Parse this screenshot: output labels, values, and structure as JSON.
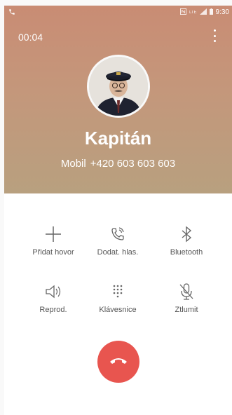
{
  "status_bar": {
    "left_icon": "phone-call-icon",
    "right_icons": [
      "nfc-icon",
      "lte-icon",
      "signal-icon",
      "battery-icon"
    ],
    "lte_label": "LTE",
    "time": "9:30"
  },
  "call": {
    "timer": "00:04",
    "contact_name": "Kapitán",
    "number_label": "Mobil",
    "number": "+420 603 603 603"
  },
  "controls": [
    {
      "id": "add-call",
      "label": "Přidat hovor",
      "icon": "plus-icon"
    },
    {
      "id": "add-voice",
      "label": "Dodat. hlas.",
      "icon": "phone-wave-icon"
    },
    {
      "id": "bluetooth",
      "label": "Bluetooth",
      "icon": "bluetooth-icon"
    },
    {
      "id": "speaker",
      "label": "Reprod.",
      "icon": "speaker-icon"
    },
    {
      "id": "keypad",
      "label": "Klávesnice",
      "icon": "keypad-icon"
    },
    {
      "id": "mute",
      "label": "Ztlumit",
      "icon": "mic-off-icon"
    }
  ],
  "colors": {
    "header_top": "#c98c74",
    "header_bottom": "#b8a07f",
    "end_call": "#e8554f",
    "control_text": "#555555"
  }
}
